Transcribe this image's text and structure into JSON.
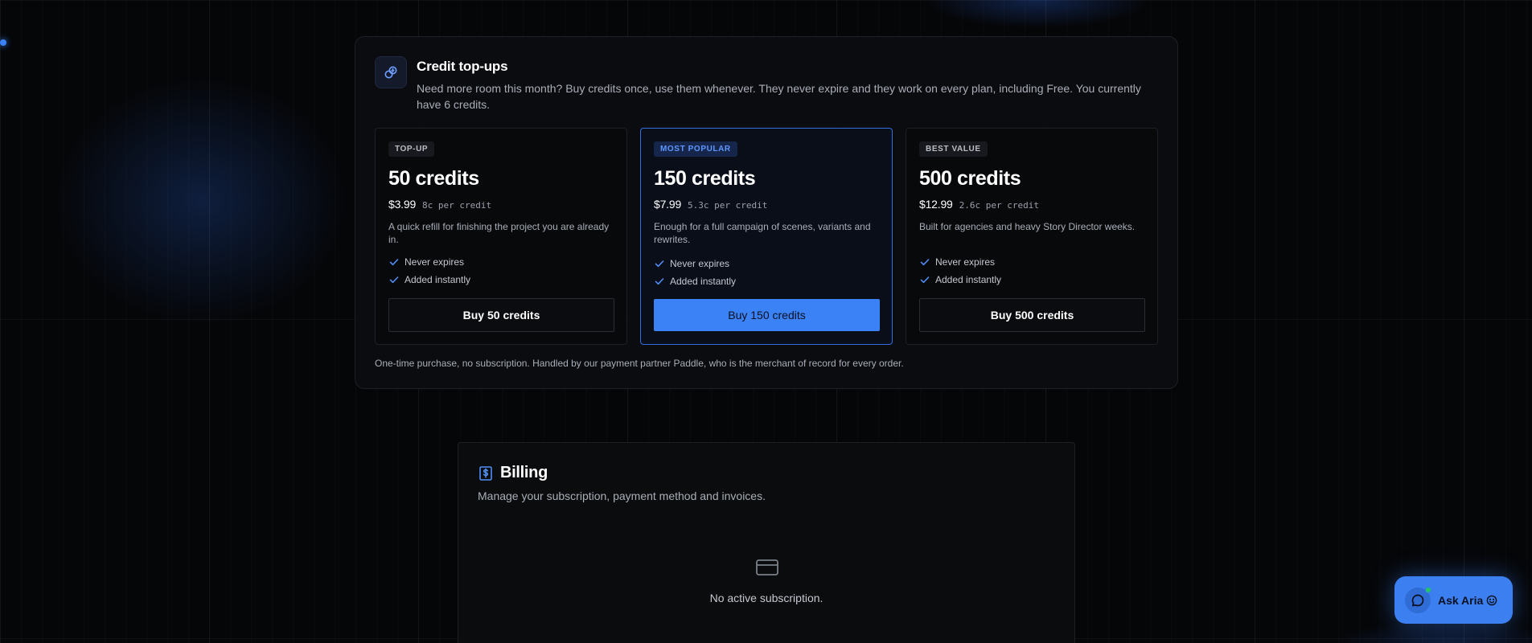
{
  "topups": {
    "icon": "link-coins-icon",
    "title": "Credit top-ups",
    "description": "Need more room this month? Buy credits once, use them whenever. They never expire and they work on every plan, including Free. You currently have 6 credits.",
    "plans": [
      {
        "badge": "TOP-UP",
        "name": "50 credits",
        "price": "$3.99",
        "per_credit": "8c per credit",
        "description": "A quick refill for finishing the project you are already in.",
        "features": [
          "Never expires",
          "Added instantly"
        ],
        "button": "Buy 50 credits",
        "highlighted": false
      },
      {
        "badge": "MOST POPULAR",
        "name": "150 credits",
        "price": "$7.99",
        "per_credit": "5.3c per credit",
        "description": "Enough for a full campaign of scenes, variants and rewrites.",
        "features": [
          "Never expires",
          "Added instantly"
        ],
        "button": "Buy 150 credits",
        "highlighted": true
      },
      {
        "badge": "BEST VALUE",
        "name": "500 credits",
        "price": "$12.99",
        "per_credit": "2.6c per credit",
        "description": "Built for agencies and heavy Story Director weeks.",
        "features": [
          "Never expires",
          "Added instantly"
        ],
        "button": "Buy 500 credits",
        "highlighted": false
      }
    ],
    "footnote": "One-time purchase, no subscription. Handled by our payment partner Paddle, who is the merchant of record for every order."
  },
  "billing": {
    "icon": "dollar-receipt-icon",
    "title": "Billing",
    "description": "Manage your subscription, payment method and invoices.",
    "empty_icon": "credit-card-icon",
    "empty_message": "No active subscription."
  },
  "assistant": {
    "icon": "chat-bubble-icon",
    "label": "Ask Aria",
    "emoji_icon": "smiley-icon",
    "online": true
  },
  "colors": {
    "accent": "#3b82f6",
    "badge_highlight_text": "#5f97ff",
    "online": "#22c55e",
    "background": "#050608"
  }
}
